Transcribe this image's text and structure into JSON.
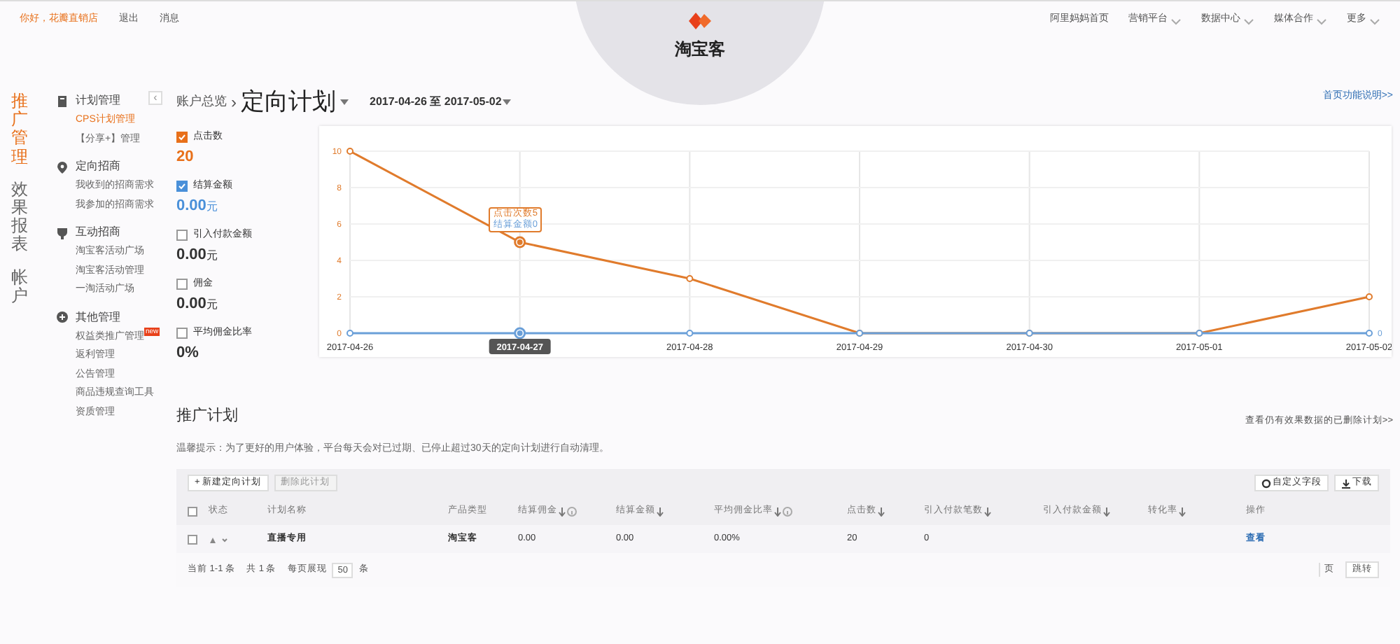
{
  "top_bar": {
    "greeting": "你好，花瓣直销店",
    "links": [
      "退出",
      "消息"
    ],
    "nav": [
      {
        "label": "阿里妈妈首页",
        "dropdown": false
      },
      {
        "label": "营销平台",
        "dropdown": true
      },
      {
        "label": "数据中心",
        "dropdown": true
      },
      {
        "label": "媒体合作",
        "dropdown": true
      },
      {
        "label": "更多",
        "dropdown": true
      }
    ]
  },
  "logo": {
    "title": "淘宝客"
  },
  "main_nav": [
    {
      "label": "推广管理",
      "selected": true
    },
    {
      "label": "效果报表",
      "selected": false
    },
    {
      "label": "帐户",
      "selected": false
    }
  ],
  "sidebar": {
    "collapse_glyph": "‹",
    "groups": [
      {
        "title": "计划管理",
        "kind": "doc",
        "items": [
          {
            "label": "CPS计划管理",
            "selected": true
          },
          {
            "label": "【分享+】管理",
            "selected": false
          }
        ]
      },
      {
        "title": "定向招商",
        "kind": "pin",
        "items": [
          {
            "label": "我收到的招商需求",
            "selected": false
          },
          {
            "label": "我参加的招商需求",
            "selected": false
          }
        ]
      },
      {
        "title": "互动招商",
        "kind": "cup",
        "items": [
          {
            "label": "淘宝客活动广场",
            "selected": false
          },
          {
            "label": "淘宝客活动管理",
            "selected": false
          },
          {
            "label": "一淘活动广场",
            "selected": false
          }
        ]
      },
      {
        "title": "其他管理",
        "kind": "plus",
        "items": [
          {
            "label": "权益类推广管理",
            "selected": false,
            "badge": "new"
          },
          {
            "label": "返利管理",
            "selected": false
          },
          {
            "label": "公告管理",
            "selected": false
          },
          {
            "label": "商品违规查询工具",
            "selected": false
          },
          {
            "label": "资质管理",
            "selected": false
          }
        ]
      }
    ]
  },
  "breadcrumb": {
    "parent": "账户总览",
    "separator": "›",
    "current": "定向计划"
  },
  "date_range": "2017-04-26 至 2017-05-02",
  "help_link": "首页功能说明>>",
  "metrics": [
    {
      "label": "点击数",
      "checked": true,
      "color": "#e8701a",
      "value": "20"
    },
    {
      "label": "结算金额",
      "checked": true,
      "color": "#4a90d9",
      "value": "0.00",
      "unit": "元"
    },
    {
      "label": "引入付款金额",
      "checked": false,
      "value": "0.00",
      "unit": "元"
    },
    {
      "label": "佣金",
      "checked": false,
      "value": "0.00",
      "unit": "元"
    },
    {
      "label": "平均佣金比率",
      "checked": false,
      "value": "0%"
    }
  ],
  "chart": {
    "chart_data": {
      "type": "line",
      "categories": [
        "2017-04-26",
        "2017-04-27",
        "2017-04-28",
        "2017-04-29",
        "2017-04-30",
        "2017-05-01",
        "2017-05-02"
      ],
      "series": [
        {
          "color": "#e07b2c",
          "marker": "circle",
          "values": [
            10,
            5,
            3,
            0,
            0,
            0,
            2
          ]
        },
        {
          "color": "#6a9fd8",
          "marker": "circle",
          "values": [
            0,
            0,
            0,
            0,
            0,
            0,
            0
          ]
        }
      ],
      "ylim": [
        0,
        10
      ],
      "yticks": [
        0,
        2,
        4,
        6,
        8,
        10
      ],
      "grid": true
    },
    "hovered": [
      false,
      true,
      false,
      false,
      false,
      false,
      false
    ],
    "tooltip": [
      "点击次数5",
      "结算金额0"
    ],
    "right_axis_label": "0"
  },
  "plans": {
    "title": "推广计划",
    "deleted_link": "查看仍有效果数据的已删除计划>>",
    "notice": "温馨提示：为了更好的用户体验，平台每天会对已过期、已停止超过30天的定向计划进行自动清理。",
    "buttons": [
      {
        "label": "+ 新建定向计划",
        "disabled": false
      },
      {
        "label": "删除此计划",
        "disabled": true
      }
    ],
    "tools": [
      {
        "label": "自定义字段",
        "kind": "gear"
      },
      {
        "label": "下载",
        "kind": "download"
      }
    ],
    "columns": [
      {
        "label": "状态",
        "sortable": false,
        "info": false
      },
      {
        "label": "计划名称",
        "sortable": false,
        "info": false
      },
      {
        "label": "产品类型",
        "sortable": false,
        "info": false
      },
      {
        "label": "结算佣金",
        "sortable": true,
        "info": true
      },
      {
        "label": "结算金额",
        "sortable": true,
        "info": false
      },
      {
        "label": "平均佣金比率",
        "sortable": true,
        "info": true
      },
      {
        "label": "点击数",
        "sortable": true,
        "info": false
      },
      {
        "label": "引入付款笔数",
        "sortable": true,
        "info": false
      },
      {
        "label": "引入付款金额",
        "sortable": true,
        "info": false
      },
      {
        "label": "转化率",
        "sortable": true,
        "info": false
      },
      {
        "label": "操作",
        "sortable": false,
        "info": false
      }
    ],
    "select_all_checked": false,
    "rows": [
      {
        "checked": false,
        "cells": [
          "",
          "直播专用",
          "淘宝客",
          "0.00",
          "0.00",
          "0.00%",
          "20",
          "0",
          "",
          ""
        ],
        "action": "查看"
      }
    ],
    "pager": {
      "current": "当前 1-1 条",
      "total": "共 1 条",
      "per_page_label": "每页展现",
      "per_page": "50",
      "per_page_unit": "条",
      "page_unit": "页",
      "jump": "跳转"
    }
  }
}
